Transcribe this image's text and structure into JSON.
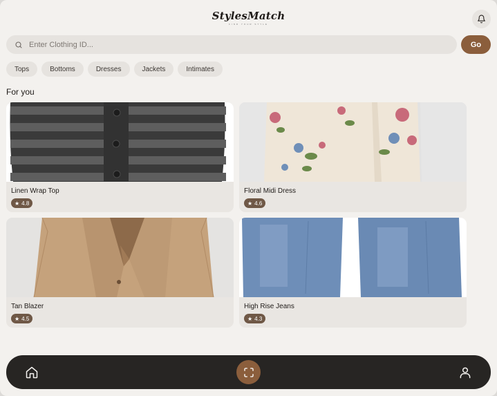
{
  "header": {
    "app_name": "StylesMatch",
    "tagline": "FIND YOUR STYLE",
    "notification_icon": "bell-icon"
  },
  "search": {
    "placeholder": "Enter Clothing ID...",
    "value": "",
    "icon": "search-icon",
    "go_label": "Go"
  },
  "categories": [
    "Tops",
    "Bottoms",
    "Dresses",
    "Jackets",
    "Intimates"
  ],
  "section_title": "For you",
  "products": [
    {
      "name": "Linen Wrap Top",
      "rating": "4.8"
    },
    {
      "name": "Floral Midi Dress",
      "rating": "4.6"
    },
    {
      "name": "Tan Blazer",
      "rating": "4.5"
    },
    {
      "name": "High Rise Jeans",
      "rating": "4.3"
    }
  ],
  "bottom_nav": {
    "items": [
      "home-icon",
      "scan-icon",
      "profile-icon"
    ]
  },
  "colors": {
    "accent": "#8b5e3c",
    "background": "#f3f1ee",
    "nav_bar": "#272523",
    "chip": "#e6e3df",
    "rating_badge": "#6f5846"
  }
}
